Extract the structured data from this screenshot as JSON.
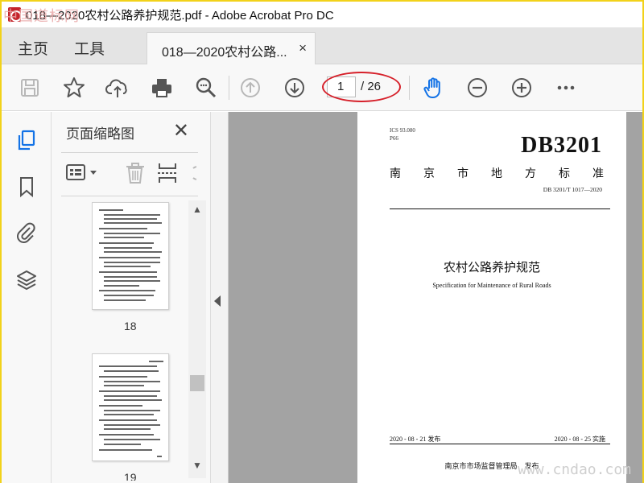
{
  "window": {
    "title": "018—2020农村公路养护规范.pdf - Adobe Acrobat Pro DC",
    "watermark_cn": "中国道标网",
    "watermark_url": "www.cndao.com"
  },
  "nav": {
    "home": "主页",
    "tools": "工具",
    "tab_label": "018—2020农村公路...",
    "tab_close": "×"
  },
  "toolbar": {
    "icons": [
      "save-icon",
      "bookmark-star-icon",
      "upload-cloud-icon",
      "print-icon",
      "zoom-search-icon",
      "page-up-icon",
      "page-down-icon",
      "hand-tool-icon",
      "zoom-out-icon",
      "zoom-in-icon",
      "more-icon"
    ],
    "current_page": "1",
    "page_total": "/ 26",
    "accent": "#1473e6",
    "annotation_color": "#d6202a"
  },
  "rail": {
    "icons": [
      "page-thumbnails-icon",
      "bookmarks-icon",
      "attachments-icon",
      "layers-icon"
    ]
  },
  "thumbnails": {
    "title": "页面缩略图",
    "close": "✕",
    "pages": [
      "18",
      "19"
    ]
  },
  "document": {
    "ics": "ICS 93.080",
    "classification": "P66",
    "standard_id": "DB3201",
    "standard_name_chars": [
      "南",
      "京",
      "市",
      "地",
      "方",
      "标",
      "准"
    ],
    "standard_code": "DB 3201/T 1017—2020",
    "title_cn": "农村公路养护规范",
    "title_en": "Specification for Maintenance of Rural Roads",
    "publish_date": "2020 - 08 - 21 发布",
    "implement_date": "2020 - 08 - 25 实施",
    "issuer": "南京市市场监督管理局　发布"
  }
}
